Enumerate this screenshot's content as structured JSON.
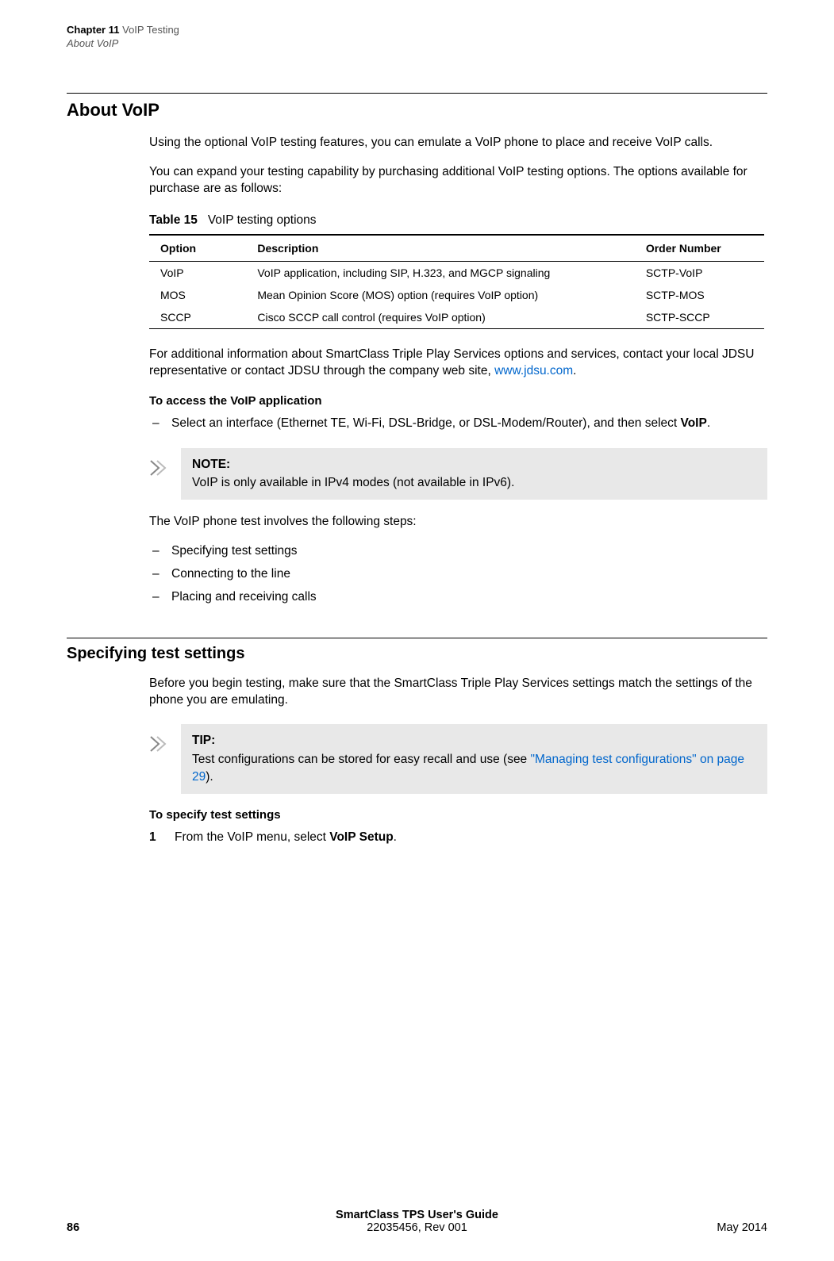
{
  "header": {
    "chapter_label": "Chapter 11",
    "chapter_title": "VoIP Testing",
    "section": "About VoIP"
  },
  "h1": "About VoIP",
  "p1": "Using the optional VoIP testing features, you can emulate a VoIP phone to place and receive VoIP calls.",
  "p2": "You can expand your testing capability by purchasing additional VoIP testing options. The options available for purchase are as follows:",
  "table_caption_label": "Table 15",
  "table_caption_title": "VoIP testing options",
  "table": {
    "headers": {
      "option": "Option",
      "description": "Description",
      "order": "Order Number"
    },
    "rows": [
      {
        "option": "VoIP",
        "description": "VoIP application, including SIP, H.323, and MGCP signaling",
        "order": "SCTP-VoIP"
      },
      {
        "option": "MOS",
        "description": "Mean Opinion Score (MOS) option (requires VoIP option)",
        "order": "SCTP-MOS"
      },
      {
        "option": "SCCP",
        "description": "Cisco SCCP call control (requires VoIP option)",
        "order": "SCTP-SCCP"
      }
    ]
  },
  "p3_pre": "For additional information about SmartClass Triple Play Services options and services, contact your local JDSU representative or contact JDSU through the company web site, ",
  "p3_link": "www.jdsu.com",
  "p3_post": ".",
  "subhead1": "To access the VoIP application",
  "step1_dash": "–",
  "step1_pre": "Select an interface (Ethernet TE, Wi-Fi, DSL-Bridge, or DSL-Modem/Router), and then select ",
  "step1_bold": "VoIP",
  "step1_post": ".",
  "note": {
    "title": "NOTE:",
    "body": "VoIP is only available in IPv4 modes (not available in IPv6)."
  },
  "p4": "The VoIP phone test involves the following steps:",
  "bullets": [
    "Specifying test settings",
    "Connecting to the line",
    "Placing and receiving calls"
  ],
  "dash": "–",
  "h2": "Specifying test settings",
  "p5": "Before you begin testing, make sure that the SmartClass Triple Play Services settings match the settings of the phone you are emulating.",
  "tip": {
    "title": "TIP:",
    "body_pre": "Test configurations can be stored for easy recall and use (see ",
    "body_link": "\"Managing test configurations\" on page 29",
    "body_post": ")."
  },
  "subhead2": "To specify test settings",
  "num1": "1",
  "step2_pre": "From the VoIP menu, select ",
  "step2_bold": "VoIP Setup",
  "step2_post": ".",
  "footer": {
    "title": "SmartClass TPS User's Guide",
    "doc": "22035456, Rev 001",
    "page": "86",
    "date": "May 2014"
  }
}
